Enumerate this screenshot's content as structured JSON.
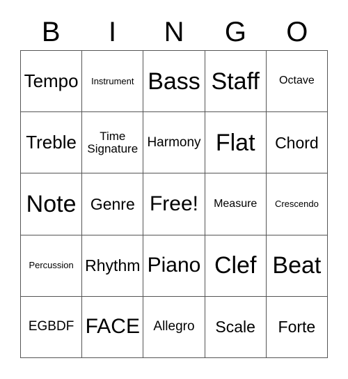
{
  "card": {
    "title": "Bingo Card",
    "header_letters": [
      "B",
      "I",
      "N",
      "G",
      "O"
    ],
    "free_space_label": "Free!",
    "colors": {
      "background": "#ffffff",
      "text": "#000000",
      "grid_line": "#555555"
    },
    "columns": 5,
    "rows": 5,
    "cells": [
      {
        "text": "Tempo",
        "size": "lg"
      },
      {
        "text": "Instrument",
        "size": "xxs"
      },
      {
        "text": "Bass",
        "size": "xxl"
      },
      {
        "text": "Staff",
        "size": "xxl"
      },
      {
        "text": "Octave",
        "size": "xs"
      },
      {
        "text": "Treble",
        "size": "lg"
      },
      {
        "text": "Time\nSignature",
        "size": "two"
      },
      {
        "text": "Harmony",
        "size": "sm"
      },
      {
        "text": "Flat",
        "size": "xxl"
      },
      {
        "text": "Chord",
        "size": "md"
      },
      {
        "text": "Note",
        "size": "xxl"
      },
      {
        "text": "Genre",
        "size": "md"
      },
      {
        "text": "Free!",
        "size": "xl"
      },
      {
        "text": "Measure",
        "size": "xs"
      },
      {
        "text": "Crescendo",
        "size": "xxs"
      },
      {
        "text": "Percussion",
        "size": "xxs"
      },
      {
        "text": "Rhythm",
        "size": "md"
      },
      {
        "text": "Piano",
        "size": "xl"
      },
      {
        "text": "Clef",
        "size": "xxl"
      },
      {
        "text": "Beat",
        "size": "xxl"
      },
      {
        "text": "EGBDF",
        "size": "sm"
      },
      {
        "text": "FACE",
        "size": "xl"
      },
      {
        "text": "Allegro",
        "size": "sm"
      },
      {
        "text": "Scale",
        "size": "md"
      },
      {
        "text": "Forte",
        "size": "md"
      }
    ]
  }
}
